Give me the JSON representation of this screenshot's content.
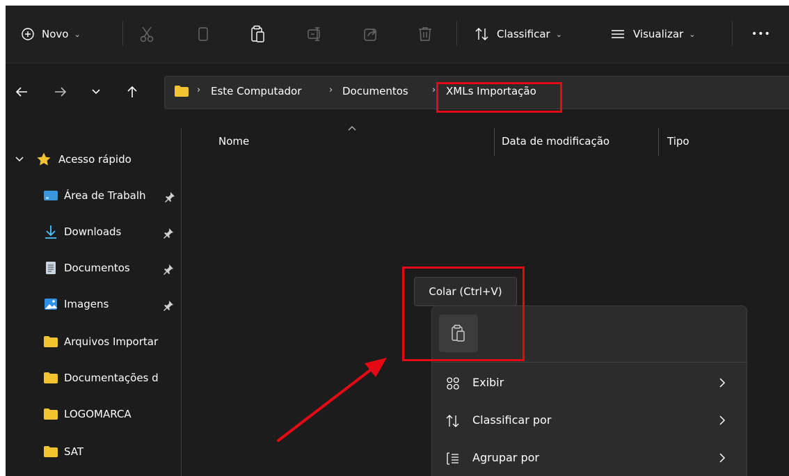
{
  "toolbar": {
    "new_label": "Novo",
    "sort_label": "Classificar",
    "view_label": "Visualizar",
    "more_label": "•••"
  },
  "address": {
    "crumbs": [
      "Este Computador",
      "Documentos",
      "XMLs Importação"
    ],
    "separator": "›"
  },
  "sidebar": {
    "quick_access": "Acesso rápido",
    "items": [
      {
        "label": "Área de Trabalh",
        "icon": "desktop-icon",
        "pinned": true
      },
      {
        "label": "Downloads",
        "icon": "download-icon",
        "pinned": true
      },
      {
        "label": "Documentos",
        "icon": "document-icon",
        "pinned": true
      },
      {
        "label": "Imagens",
        "icon": "image-icon",
        "pinned": true
      },
      {
        "label": "Arquivos Importar",
        "icon": "folder-icon",
        "pinned": false
      },
      {
        "label": "Documentações d",
        "icon": "folder-icon",
        "pinned": false
      },
      {
        "label": "LOGOMARCA",
        "icon": "folder-icon",
        "pinned": false
      },
      {
        "label": "SAT",
        "icon": "folder-icon",
        "pinned": false
      }
    ]
  },
  "columns": {
    "name": "Nome",
    "modified": "Data de modificação",
    "type": "Tipo"
  },
  "tooltip": {
    "paste": "Colar (Ctrl+V)"
  },
  "context_menu": {
    "items": [
      {
        "label": "Exibir",
        "icon": "grid-view-icon"
      },
      {
        "label": "Classificar por",
        "icon": "sort-icon"
      },
      {
        "label": "Agrupar por",
        "icon": "group-icon"
      }
    ]
  },
  "colors": {
    "highlight": "#e50914",
    "folder": "#f4c430",
    "accent": "#4cc2ff"
  }
}
